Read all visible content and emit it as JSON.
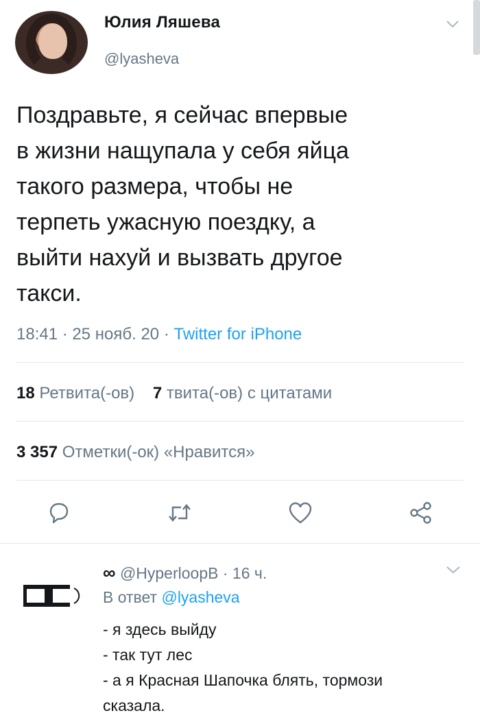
{
  "tweet": {
    "author_name": "Юлия Ляшева",
    "author_handle": "@lyasheva",
    "text": "Поздравьте, я сейчас впервые\nв жизни нащупала у себя яйца\nтакого размера, чтобы не\nтерпеть ужасную поездку, а\nвыйти нахуй и вызвать другое\nтакси.",
    "time": "18:41",
    "date": "25 нояб. 20",
    "separator": "·",
    "source": "Twitter for iPhone",
    "retweets_count": "18",
    "retweets_label": "Ретвита(-ов)",
    "quotes_count": "7",
    "quotes_label": "твита(-ов) с цитатами",
    "likes_count": "3 357",
    "likes_label": "Отметки(-ок) «Нравится»"
  },
  "reply": {
    "display_name": "∞",
    "handle": "@HyperloopB",
    "separator": "·",
    "time": "16 ч.",
    "reply_to_label": "В ответ",
    "reply_to_handle": "@lyasheva",
    "text": "- я здесь выйду\n- так тут лес\n- а я Красная Шапочка блять, тормози\nсказала."
  },
  "icons": {
    "menu": "chevron-down-icon",
    "reply": "reply-icon",
    "retweet": "retweet-icon",
    "like": "heart-icon",
    "share": "share-icon",
    "reply_avatar": "logo-icon"
  },
  "colors": {
    "accent": "#1da1f2",
    "secondary_text": "#657786",
    "primary_text": "#14171a",
    "divider": "#e1e8ed"
  }
}
